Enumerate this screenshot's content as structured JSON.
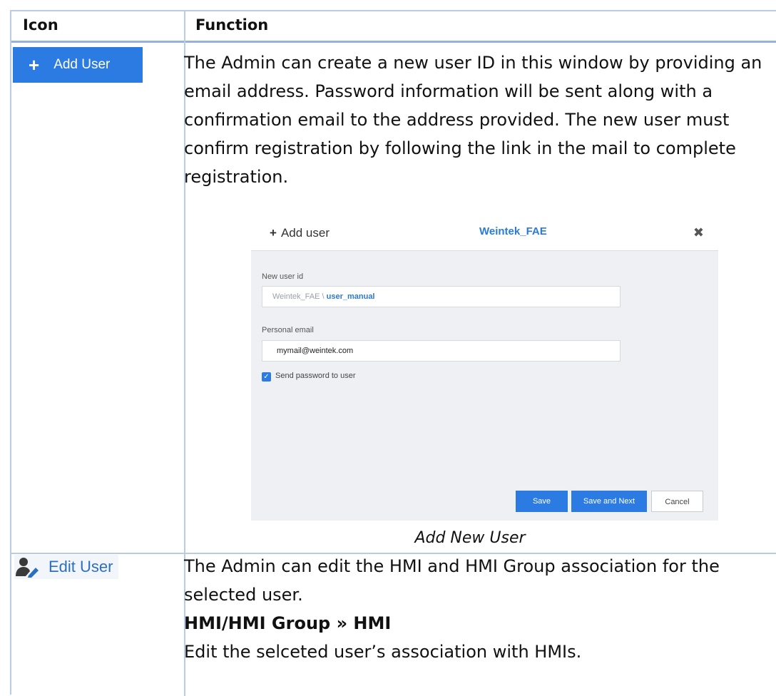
{
  "table": {
    "col_icon": "Icon",
    "col_function": "Function"
  },
  "row1": {
    "button_label": "Add User",
    "button_plus": "+",
    "description": "The Admin can create a new user ID in this window by providing an email address. Password information will be sent along with a confirmation email to the address provided. The new user must confirm registration by following the link in the mail to complete registration.",
    "dialog": {
      "title_plus": "+",
      "title": "Add user",
      "tenant": "Weintek_FAE",
      "close": "✖",
      "new_user_id_label": "New user id",
      "user_id_prefix": "Weintek_FAE \\",
      "user_id_value": "user_manual",
      "personal_email_label": "Personal email",
      "personal_email_value": "mymail@weintek.com",
      "send_password_label": "Send password to user",
      "save": "Save",
      "save_next": "Save and Next",
      "cancel": "Cancel"
    },
    "caption": "Add New User"
  },
  "row2": {
    "button_label": "Edit User",
    "line1": "The Admin can edit the HMI and HMI Group association for the selected user.",
    "heading": "HMI/HMI Group » HMI",
    "line2": "Edit the selceted user’s association with HMIs."
  },
  "colors": {
    "primary": "#2b7be2",
    "link": "#2a7ad8",
    "border": "#b8cce4",
    "header_rule": "#95b3d7"
  }
}
